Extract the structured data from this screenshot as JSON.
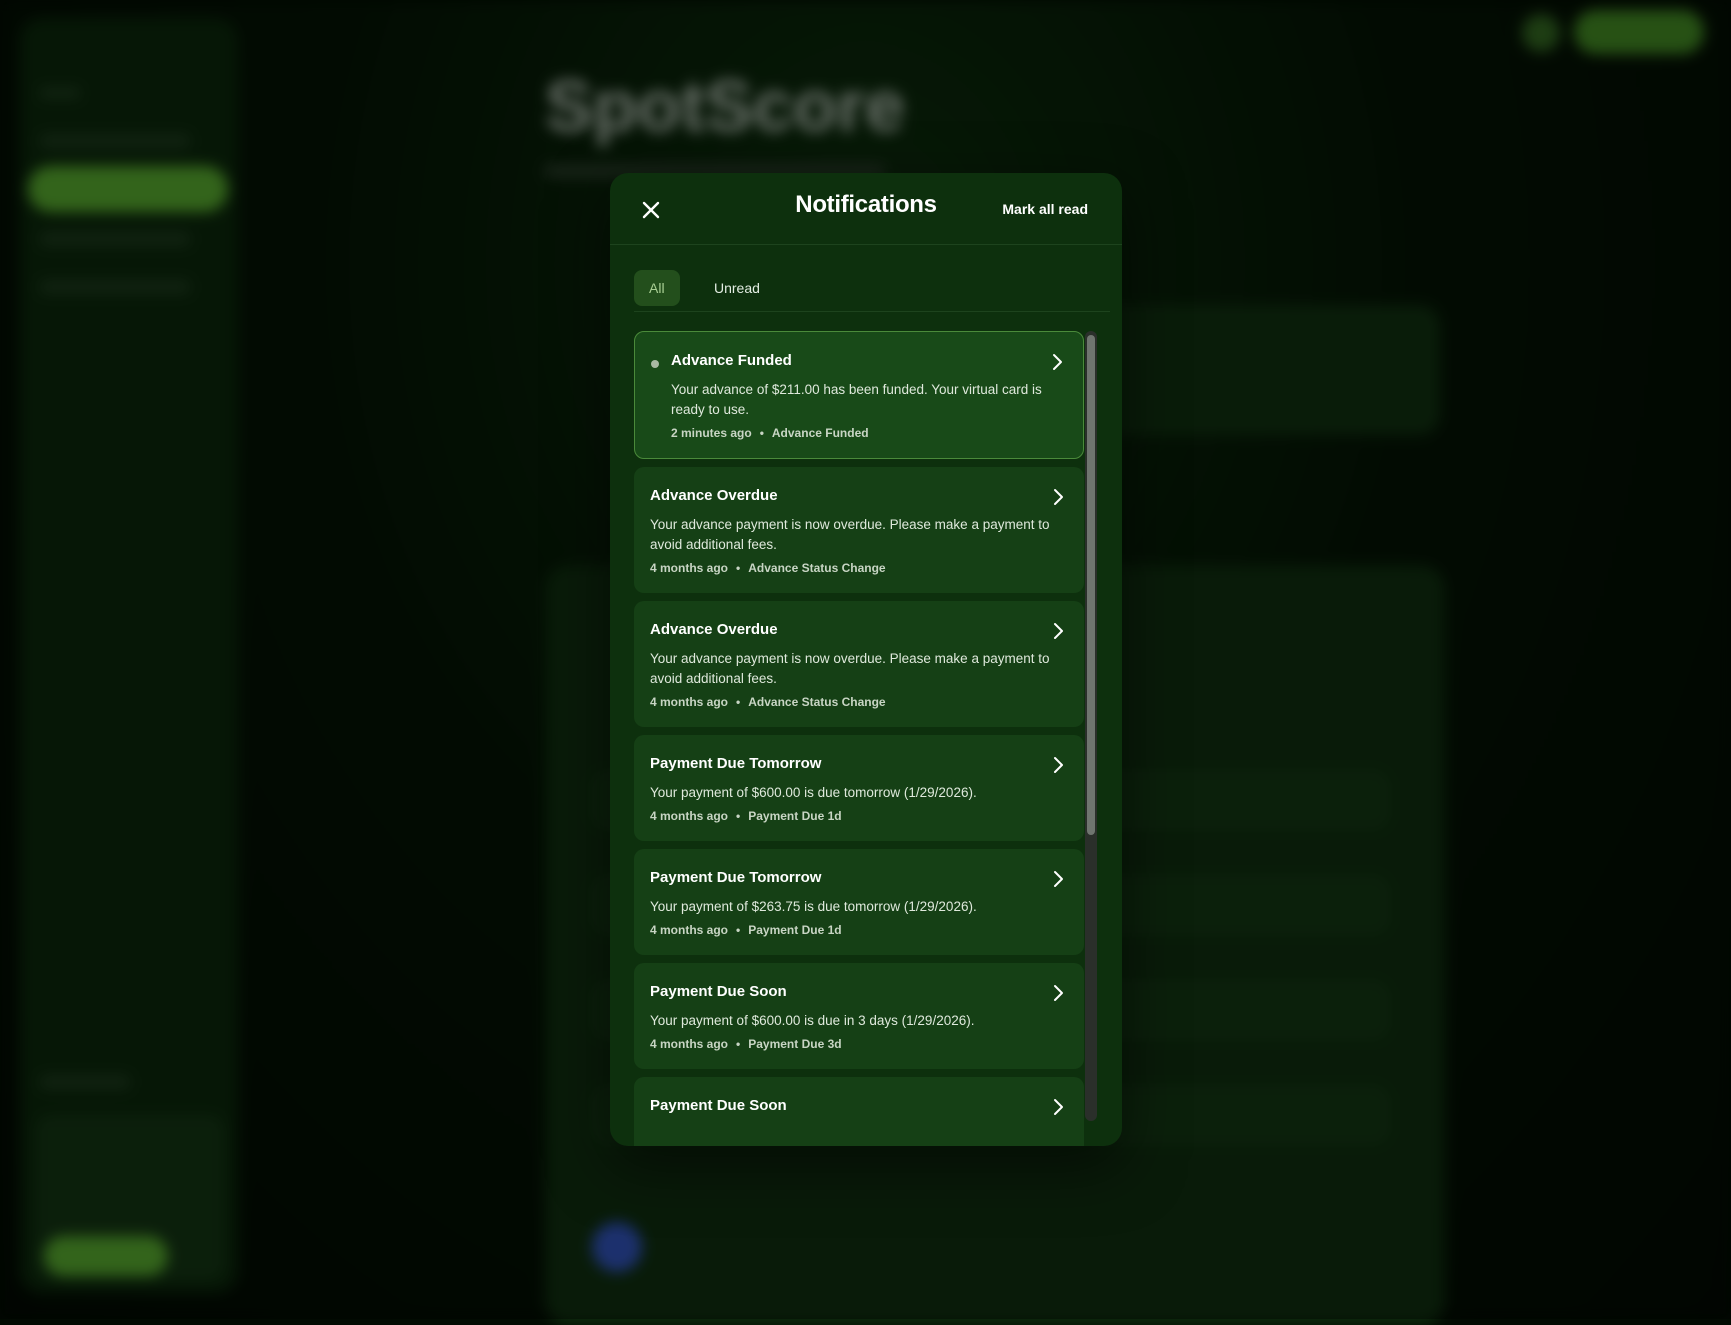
{
  "background": {
    "app_title": "SpotScore"
  },
  "modal": {
    "title": "Notifications",
    "mark_all_label": "Mark all read",
    "tabs": [
      {
        "label": "All",
        "active": true
      },
      {
        "label": "Unread",
        "active": false
      }
    ],
    "notifications": [
      {
        "title": "Advance Funded",
        "body": "Your advance of $211.00 has been funded. Your virtual card is ready to use.",
        "time": "2 minutes ago",
        "category": "Advance Funded",
        "unread": true
      },
      {
        "title": "Advance Overdue",
        "body": "Your advance payment is now overdue. Please make a payment to avoid additional fees.",
        "time": "4 months ago",
        "category": "Advance Status Change",
        "unread": false
      },
      {
        "title": "Advance Overdue",
        "body": "Your advance payment is now overdue. Please make a payment to avoid additional fees.",
        "time": "4 months ago",
        "category": "Advance Status Change",
        "unread": false
      },
      {
        "title": "Payment Due Tomorrow",
        "body": "Your payment of $600.00 is due tomorrow (1/29/2026).",
        "time": "4 months ago",
        "category": "Payment Due 1d",
        "unread": false
      },
      {
        "title": "Payment Due Tomorrow",
        "body": "Your payment of $263.75 is due tomorrow (1/29/2026).",
        "time": "4 months ago",
        "category": "Payment Due 1d",
        "unread": false
      },
      {
        "title": "Payment Due Soon",
        "body": "Your payment of $600.00 is due in 3 days (1/29/2026).",
        "time": "4 months ago",
        "category": "Payment Due 3d",
        "unread": false
      },
      {
        "title": "Payment Due Soon",
        "body": "",
        "time": "",
        "category": "",
        "unread": false
      }
    ]
  },
  "colors": {
    "modal_bg": "#0d300d",
    "item_bg": "#154015",
    "unread_border": "#4a8a3a",
    "tab_active_bg": "#234f1c",
    "tab_active_text": "#a9cf94"
  }
}
